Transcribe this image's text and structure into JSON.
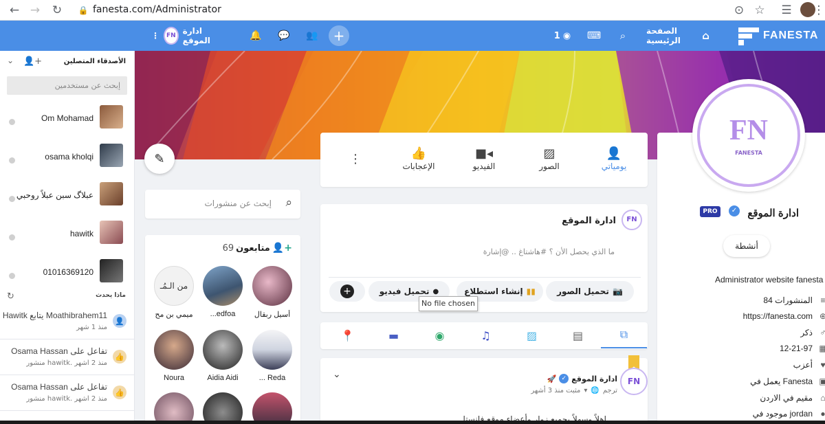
{
  "browser": {
    "url": "fanesta.com/Administrator"
  },
  "header": {
    "logo_text": "FANESTA",
    "home_label": "الصفحة الرئيسية",
    "views_count": "1",
    "page_name": "ادارة الموقع",
    "avatar_text": "FN",
    "brand_color": "#4a8ee6"
  },
  "sidebar": {
    "title": "الأصدقاء المتصلين",
    "search_placeholder": "إبحث عن مستخدمين",
    "friends": [
      "Om Mohamad",
      "osama kholqi",
      "عبلاگ سبن عبلاً روحبي",
      "hawitk",
      "01016369120"
    ],
    "activity_title": "ماذا يحدث",
    "activities": [
      {
        "line1": "Hawitk يتابع Moathibrahem11",
        "line2": "منذ 1 شهر"
      },
      {
        "line1": "Osama Hassan تفاعل على",
        "line2": "منشور hawitk. منذ 2 اشهر"
      },
      {
        "line1": "Osama Hassan تفاعل على",
        "line2": "منشور hawitk. منذ 2 اشهر"
      }
    ]
  },
  "profile": {
    "avatar_text": "FN",
    "avatar_sub": "FANESTA",
    "name": "ادارة الموقع",
    "badge": "PRO",
    "activity_button": "أنشطة",
    "bio": "Administrator website fanesta",
    "info": [
      {
        "icon": "≡",
        "text": "84 المنشورات"
      },
      {
        "icon": "⊕",
        "text": "https://fanesta.com"
      },
      {
        "icon": "♂",
        "text": "ذكر"
      },
      {
        "icon": "▦",
        "text": "12-21-97"
      },
      {
        "icon": "♥",
        "text": "أعزب"
      },
      {
        "icon": "▣",
        "text": "يعمل في Fanesta"
      },
      {
        "icon": "⌂",
        "text": "مقيم في الاردن"
      },
      {
        "icon": "●",
        "text": "موجود في jordan"
      }
    ]
  },
  "profile_tabs": [
    {
      "label": "يومياتي",
      "icon": "👤",
      "active": true
    },
    {
      "label": "الصور",
      "icon": "🖼"
    },
    {
      "label": "الفيديو",
      "icon": "🎥"
    },
    {
      "label": "الإعجابات",
      "icon": "👍"
    }
  ],
  "post_search": {
    "placeholder": "إبحث عن منشورات"
  },
  "followers": {
    "title": "متابعون",
    "count": "69",
    "names": [
      "أسيل ربقال",
      "...edfoa",
      "ميمي بن مح",
      "... Reda",
      "Aidia Aidi",
      "Noura"
    ]
  },
  "composer": {
    "name": "ادارة الموقع",
    "placeholder": "ما الذي يحصل الأن ؟ #هاشتاغ .. @إشارة",
    "btn_photo": "تحميل الصور",
    "btn_poll": "إنشاء استطلاع",
    "btn_video": "تحميل فيديو",
    "file_tooltip": "No file chosen"
  },
  "post": {
    "author": "ادارة الموقع",
    "meta": "مثبت منذ 3 أشهر",
    "translate": "ترجم",
    "text": "اهلاً وسهلاً بجميع زوار وأعضاء موقع فانستا"
  }
}
